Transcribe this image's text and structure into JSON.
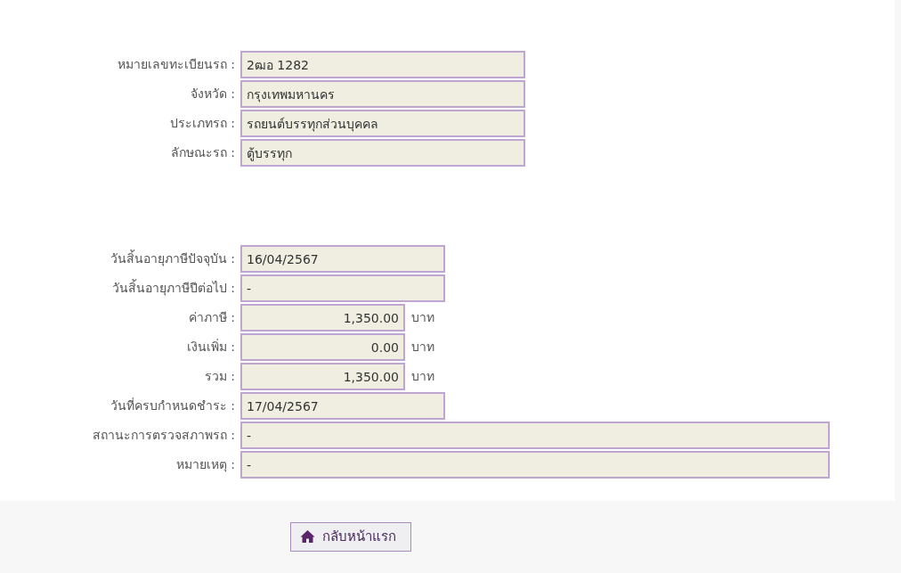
{
  "vehicle": [
    {
      "label": "หมายเลขทะเบียนรถ :",
      "value": "2ฒอ 1282",
      "kind": "text"
    },
    {
      "label": "จังหวัด :",
      "value": "กรุงเทพมหานคร",
      "kind": "text"
    },
    {
      "label": "ประเภทรถ :",
      "value": "รถยนต์บรรทุกส่วนบุคคล",
      "kind": "text"
    },
    {
      "label": "ลักษณะรถ :",
      "value": "ตู้บรรทุก",
      "kind": "text"
    }
  ],
  "tax": [
    {
      "label": "วันสิ้นอายุภาษีปัจจุบัน :",
      "value": "16/04/2567",
      "kind": "date"
    },
    {
      "label": "วันสิ้นอายุภาษีปีต่อไป :",
      "value": "-",
      "kind": "date"
    },
    {
      "label": "ค่าภาษี :",
      "value": "1,350.00",
      "kind": "amount",
      "unit": "บาท"
    },
    {
      "label": "เงินเพิ่ม :",
      "value": "0.00",
      "kind": "amount",
      "unit": "บาท"
    },
    {
      "label": "รวม :",
      "value": "1,350.00",
      "kind": "amount",
      "unit": "บาท"
    },
    {
      "label": "วันที่ครบกำหนดชำระ :",
      "value": "17/04/2567",
      "kind": "date"
    },
    {
      "label": "สถานะการตรวจสภาพรถ :",
      "value": "-",
      "kind": "wide"
    },
    {
      "label": "หมายเหตุ :",
      "value": "-",
      "kind": "wide"
    }
  ],
  "home_button": {
    "label": "กลับหน้าแรก"
  }
}
